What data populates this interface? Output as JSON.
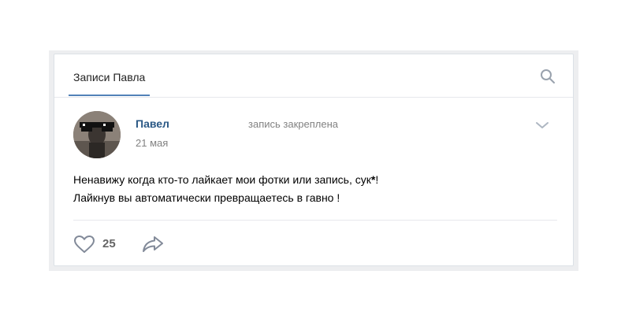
{
  "tabs": {
    "active_label": "Записи Павла"
  },
  "icons": {
    "search": "search-icon",
    "chevron": "chevron-down-icon",
    "like": "heart-icon",
    "share": "share-icon"
  },
  "post": {
    "author": "Павел",
    "status": "запись закреплена",
    "date": "21 мая",
    "text_line1_main": "Ненавижу когда кто-то лайкает мои фотки или запись, сук",
    "text_line1_star": "*",
    "text_line1_end": "!",
    "text_line2": "Лайкнув вы автоматически превращаетесь в гавно !",
    "likes": "25"
  },
  "colors": {
    "link": "#2a5885",
    "accent": "#5181b8",
    "muted": "#828282",
    "icon": "#99a2ad"
  }
}
